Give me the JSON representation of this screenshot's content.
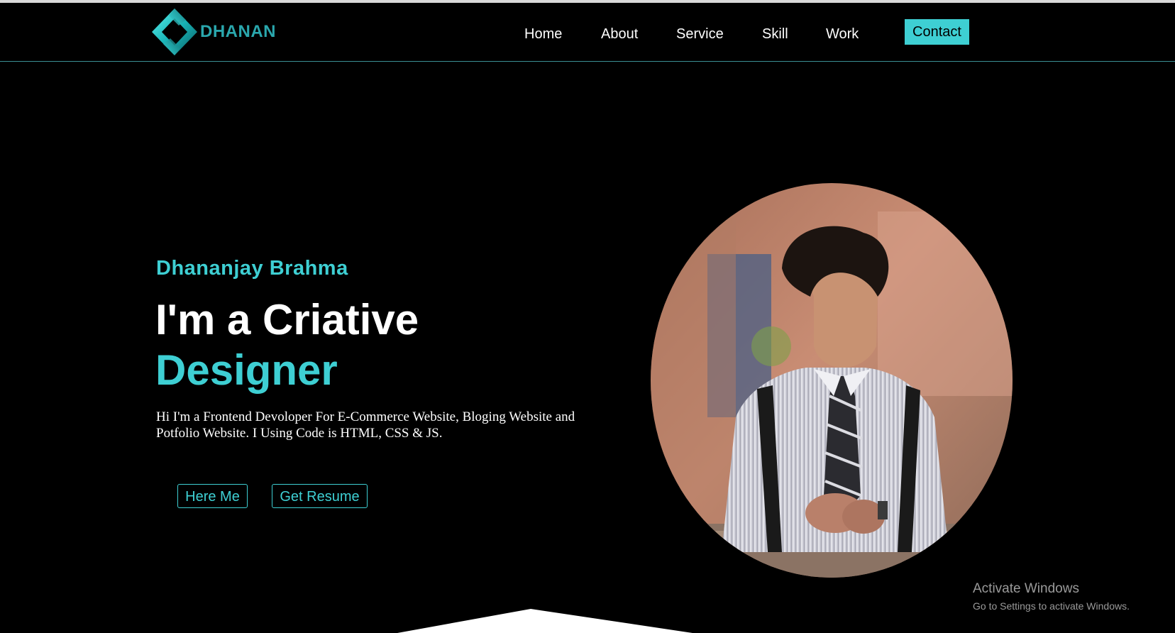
{
  "brand": {
    "name": "DHANAN",
    "accent_color": "#3ecfd3",
    "logo_icon": "diamond-ribbon-logo-icon"
  },
  "nav": {
    "items": [
      {
        "label": "Home"
      },
      {
        "label": "About"
      },
      {
        "label": "Service"
      },
      {
        "label": "Skill"
      },
      {
        "label": "Work"
      }
    ],
    "contact_label": "Contact"
  },
  "hero": {
    "name": "Dhananjay Brahma",
    "headline_line1": "I'm a Criative",
    "headline_line2": "Designer",
    "description": "Hi I'm a Frontend Devoloper For E-Commerce Website, Bloging Website and Potfolio Website. I Using Code is HTML, CSS & JS.",
    "buttons": {
      "hire_label": "Here Me",
      "resume_label": "Get Resume"
    },
    "photo_alt": "portrait-photo"
  },
  "watermark": {
    "title": "Activate Windows",
    "subtitle": "Go to Settings to activate Windows."
  }
}
